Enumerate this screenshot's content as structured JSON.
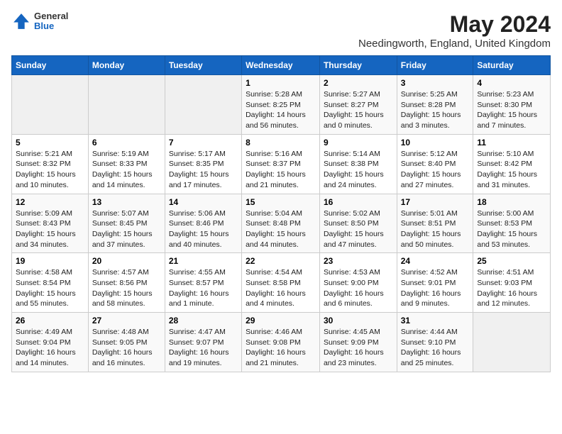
{
  "header": {
    "logo_general": "General",
    "logo_blue": "Blue",
    "month_title": "May 2024",
    "location": "Needingworth, England, United Kingdom"
  },
  "days_of_week": [
    "Sunday",
    "Monday",
    "Tuesday",
    "Wednesday",
    "Thursday",
    "Friday",
    "Saturday"
  ],
  "weeks": [
    [
      {
        "num": "",
        "info": ""
      },
      {
        "num": "",
        "info": ""
      },
      {
        "num": "",
        "info": ""
      },
      {
        "num": "1",
        "info": "Sunrise: 5:28 AM\nSunset: 8:25 PM\nDaylight: 14 hours\nand 56 minutes."
      },
      {
        "num": "2",
        "info": "Sunrise: 5:27 AM\nSunset: 8:27 PM\nDaylight: 15 hours\nand 0 minutes."
      },
      {
        "num": "3",
        "info": "Sunrise: 5:25 AM\nSunset: 8:28 PM\nDaylight: 15 hours\nand 3 minutes."
      },
      {
        "num": "4",
        "info": "Sunrise: 5:23 AM\nSunset: 8:30 PM\nDaylight: 15 hours\nand 7 minutes."
      }
    ],
    [
      {
        "num": "5",
        "info": "Sunrise: 5:21 AM\nSunset: 8:32 PM\nDaylight: 15 hours\nand 10 minutes."
      },
      {
        "num": "6",
        "info": "Sunrise: 5:19 AM\nSunset: 8:33 PM\nDaylight: 15 hours\nand 14 minutes."
      },
      {
        "num": "7",
        "info": "Sunrise: 5:17 AM\nSunset: 8:35 PM\nDaylight: 15 hours\nand 17 minutes."
      },
      {
        "num": "8",
        "info": "Sunrise: 5:16 AM\nSunset: 8:37 PM\nDaylight: 15 hours\nand 21 minutes."
      },
      {
        "num": "9",
        "info": "Sunrise: 5:14 AM\nSunset: 8:38 PM\nDaylight: 15 hours\nand 24 minutes."
      },
      {
        "num": "10",
        "info": "Sunrise: 5:12 AM\nSunset: 8:40 PM\nDaylight: 15 hours\nand 27 minutes."
      },
      {
        "num": "11",
        "info": "Sunrise: 5:10 AM\nSunset: 8:42 PM\nDaylight: 15 hours\nand 31 minutes."
      }
    ],
    [
      {
        "num": "12",
        "info": "Sunrise: 5:09 AM\nSunset: 8:43 PM\nDaylight: 15 hours\nand 34 minutes."
      },
      {
        "num": "13",
        "info": "Sunrise: 5:07 AM\nSunset: 8:45 PM\nDaylight: 15 hours\nand 37 minutes."
      },
      {
        "num": "14",
        "info": "Sunrise: 5:06 AM\nSunset: 8:46 PM\nDaylight: 15 hours\nand 40 minutes."
      },
      {
        "num": "15",
        "info": "Sunrise: 5:04 AM\nSunset: 8:48 PM\nDaylight: 15 hours\nand 44 minutes."
      },
      {
        "num": "16",
        "info": "Sunrise: 5:02 AM\nSunset: 8:50 PM\nDaylight: 15 hours\nand 47 minutes."
      },
      {
        "num": "17",
        "info": "Sunrise: 5:01 AM\nSunset: 8:51 PM\nDaylight: 15 hours\nand 50 minutes."
      },
      {
        "num": "18",
        "info": "Sunrise: 5:00 AM\nSunset: 8:53 PM\nDaylight: 15 hours\nand 53 minutes."
      }
    ],
    [
      {
        "num": "19",
        "info": "Sunrise: 4:58 AM\nSunset: 8:54 PM\nDaylight: 15 hours\nand 55 minutes."
      },
      {
        "num": "20",
        "info": "Sunrise: 4:57 AM\nSunset: 8:56 PM\nDaylight: 15 hours\nand 58 minutes."
      },
      {
        "num": "21",
        "info": "Sunrise: 4:55 AM\nSunset: 8:57 PM\nDaylight: 16 hours\nand 1 minute."
      },
      {
        "num": "22",
        "info": "Sunrise: 4:54 AM\nSunset: 8:58 PM\nDaylight: 16 hours\nand 4 minutes."
      },
      {
        "num": "23",
        "info": "Sunrise: 4:53 AM\nSunset: 9:00 PM\nDaylight: 16 hours\nand 6 minutes."
      },
      {
        "num": "24",
        "info": "Sunrise: 4:52 AM\nSunset: 9:01 PM\nDaylight: 16 hours\nand 9 minutes."
      },
      {
        "num": "25",
        "info": "Sunrise: 4:51 AM\nSunset: 9:03 PM\nDaylight: 16 hours\nand 12 minutes."
      }
    ],
    [
      {
        "num": "26",
        "info": "Sunrise: 4:49 AM\nSunset: 9:04 PM\nDaylight: 16 hours\nand 14 minutes."
      },
      {
        "num": "27",
        "info": "Sunrise: 4:48 AM\nSunset: 9:05 PM\nDaylight: 16 hours\nand 16 minutes."
      },
      {
        "num": "28",
        "info": "Sunrise: 4:47 AM\nSunset: 9:07 PM\nDaylight: 16 hours\nand 19 minutes."
      },
      {
        "num": "29",
        "info": "Sunrise: 4:46 AM\nSunset: 9:08 PM\nDaylight: 16 hours\nand 21 minutes."
      },
      {
        "num": "30",
        "info": "Sunrise: 4:45 AM\nSunset: 9:09 PM\nDaylight: 16 hours\nand 23 minutes."
      },
      {
        "num": "31",
        "info": "Sunrise: 4:44 AM\nSunset: 9:10 PM\nDaylight: 16 hours\nand 25 minutes."
      },
      {
        "num": "",
        "info": ""
      }
    ]
  ]
}
